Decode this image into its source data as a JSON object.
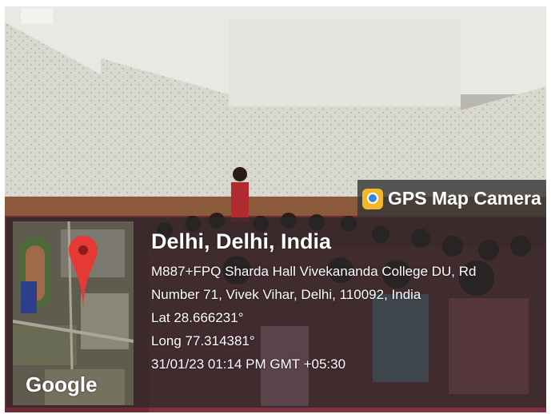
{
  "stamp": {
    "app_name": "GPS Map Camera",
    "city": "Delhi, Delhi, India",
    "address_line1": "M887+FPQ Sharda Hall Vivekananda College DU, Rd",
    "address_line2": "Number 71, Vivek Vihar, Delhi, 110092, India",
    "latitude": "Lat 28.666231°",
    "longitude": "Long 77.314381°",
    "timestamp": "31/01/23 01:14 PM GMT +05:30",
    "map_provider": "Google"
  },
  "colors": {
    "pin": "#e53935",
    "overlay": "#282828",
    "app_icon": "#f3b829"
  }
}
